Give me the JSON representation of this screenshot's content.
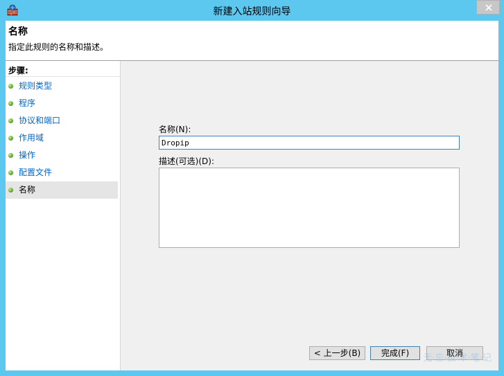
{
  "window": {
    "title": "新建入站规则向导",
    "icon": "firewall-wizard-icon"
  },
  "header": {
    "title": "名称",
    "description": "指定此规则的名称和描述。"
  },
  "steps": {
    "label": "步骤:",
    "items": [
      {
        "label": "规则类型"
      },
      {
        "label": "程序"
      },
      {
        "label": "协议和端口"
      },
      {
        "label": "作用域"
      },
      {
        "label": "操作"
      },
      {
        "label": "配置文件"
      },
      {
        "label": "名称",
        "current": true
      }
    ]
  },
  "form": {
    "name_label": "名称(N):",
    "name_value": "Dropip",
    "description_label": "描述(可选)(D):",
    "description_value": ""
  },
  "buttons": {
    "back": "< 上一步(B)",
    "finish": "完成(F)",
    "cancel": "取消"
  },
  "watermark": "无·忘·技·术·笔·记",
  "colors": {
    "title_bar": "#5cc8ef",
    "link": "#0066cc",
    "step_dot": "#5aa52a"
  }
}
